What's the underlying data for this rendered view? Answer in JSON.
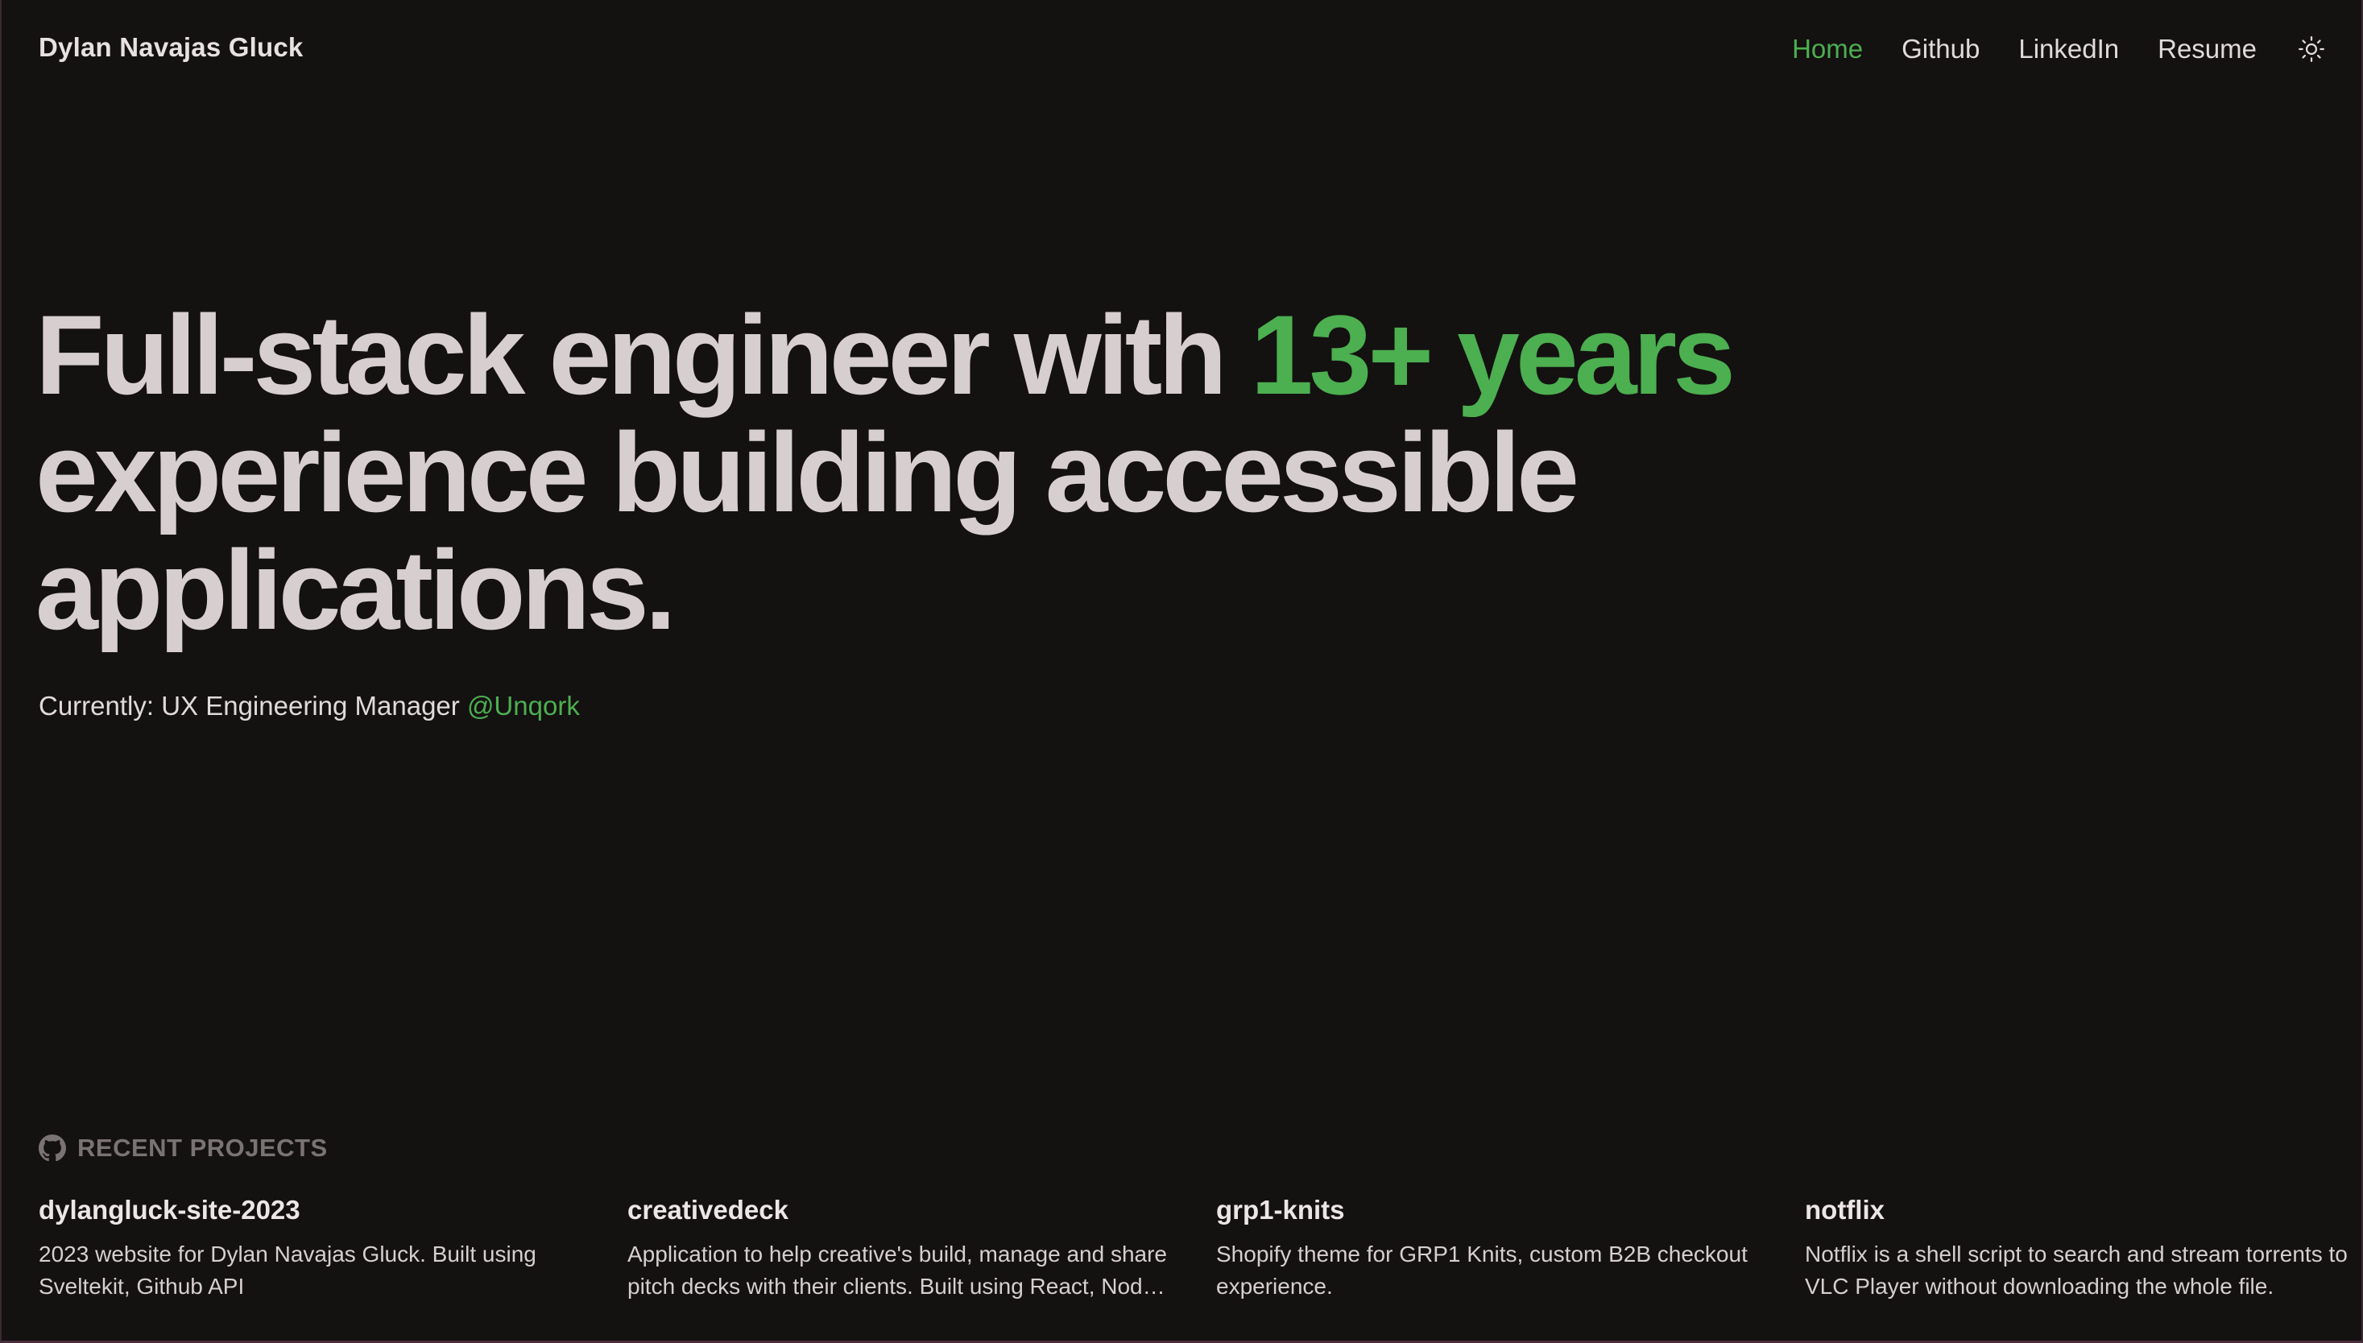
{
  "header": {
    "site_name": "Dylan Navajas Gluck",
    "nav": [
      {
        "label": "Home",
        "active": true
      },
      {
        "label": "Github",
        "active": false
      },
      {
        "label": "LinkedIn",
        "active": false
      },
      {
        "label": "Resume",
        "active": false
      }
    ],
    "theme_toggle_icon": "sun-icon"
  },
  "hero": {
    "title_part1": "Full-stack engineer with ",
    "title_accent": "13+ years",
    "title_part2": " experience building accessible applications.",
    "current_prefix": "Currently: UX Engineering Manager ",
    "current_link": "@Unqork"
  },
  "projects": {
    "heading": "RECENT PROJECTS",
    "heading_icon": "github-icon",
    "items": [
      {
        "name": "dylangluck-site-2023",
        "description": "2023 website for Dylan Navajas Gluck. Built using Sveltekit, Github API"
      },
      {
        "name": "creativedeck",
        "description": "Application to help creative's build, manage and share pitch decks with their clients. Built using React, Node and Firebase."
      },
      {
        "name": "grp1-knits",
        "description": "Shopify theme for GRP1 Knits, custom B2B checkout experience."
      },
      {
        "name": "notflix",
        "description": "Notflix is a shell script to search and stream torrents to VLC Player without downloading the whole file."
      }
    ]
  },
  "colors": {
    "background": "#141111",
    "accent": "#4caf50",
    "text": "#d7cfcf",
    "muted": "#7a7373"
  }
}
